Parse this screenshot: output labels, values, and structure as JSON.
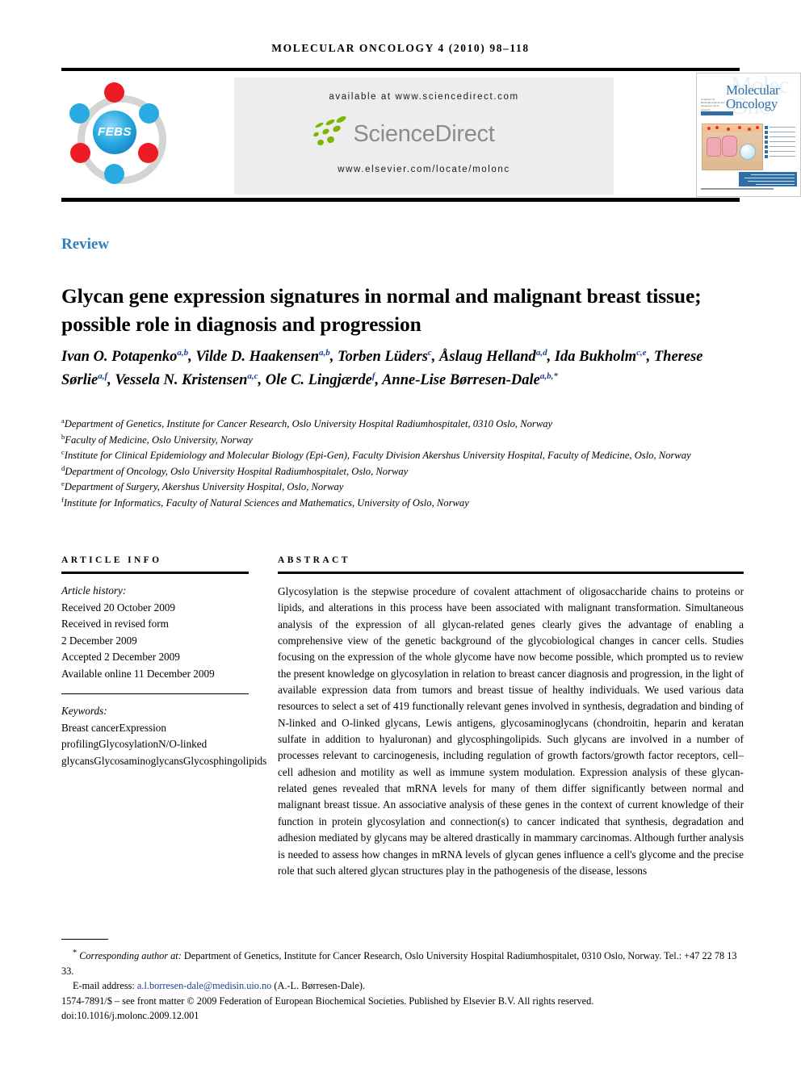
{
  "running_head": "MOLECULAR ONCOLOGY 4 (2010) 98–118",
  "masthead": {
    "febs_logo_text": "FEBS",
    "available_at": "available at www.sciencedirect.com",
    "sciencedirect_logo_text": "ScienceDirect",
    "journal_url": "www.elsevier.com/locate/molonc"
  },
  "cover": {
    "title_line1": "Molecular",
    "title_line2": "Oncology",
    "ghost_line1": "Molec",
    "ghost_line2": "Onc",
    "subtitle": "A quarter for Biotechnological and advanced cancer research",
    "footer_text": "www.elsevier.com/locate/molonc  Volume 4  Issue 2  April 2010"
  },
  "article_type": "Review",
  "title": "Glycan gene expression signatures in normal and malignant breast tissue; possible role in diagnosis and progression",
  "authors": [
    {
      "name": "Ivan O. Potapenko",
      "sup": "a,b",
      "sep": ", "
    },
    {
      "name": "Vilde D. Haakensen",
      "sup": "a,b",
      "sep": ", "
    },
    {
      "name": "Torben Lüders",
      "sup": "c",
      "sep": ",  "
    },
    {
      "name": "Åslaug Helland",
      "sup": "a,d",
      "sep": ", "
    },
    {
      "name": "Ida Bukholm",
      "sup": "c,e",
      "sep": ", "
    },
    {
      "name": "Therese Sørlie",
      "sup": "a,f",
      "sep": ", "
    },
    {
      "name": "Vessela N. Kristensen",
      "sup": "a,c",
      "sep": ", "
    },
    {
      "name": "Ole C. Lingjærde",
      "sup": "f",
      "sep": ", "
    },
    {
      "name": "Anne-Lise Børresen-Dale",
      "sup": "a,b,*",
      "sep": ""
    }
  ],
  "affiliations": [
    {
      "mark": "a",
      "text": "Department of Genetics, Institute for Cancer Research, Oslo University Hospital Radiumhospitalet, 0310 Oslo, Norway"
    },
    {
      "mark": "b",
      "text": "Faculty of Medicine, Oslo University, Norway"
    },
    {
      "mark": "c",
      "text": "Institute for Clinical Epidemiology and Molecular Biology (Epi-Gen), Faculty Division Akershus University Hospital, Faculty of Medicine, Oslo, Norway"
    },
    {
      "mark": "d",
      "text": "Department of Oncology, Oslo University Hospital Radiumhospitalet, Oslo, Norway"
    },
    {
      "mark": "e",
      "text": "Department of Surgery, Akershus University Hospital, Oslo, Norway"
    },
    {
      "mark": "f",
      "text": "Institute for Informatics, Faculty of Natural Sciences and Mathematics, University of Oslo, Norway"
    }
  ],
  "article_info": {
    "heading": "ARTICLE INFO",
    "history_label": "Article history:",
    "history_lines": [
      "Received 20 October 2009",
      "Received in revised form",
      "2 December 2009",
      "Accepted 2 December 2009",
      "Available online 11 December 2009"
    ],
    "keywords_label": "Keywords:",
    "keywords": [
      "Breast cancer",
      "Expression profiling",
      "Glycosylation",
      "N/O-linked glycans",
      "Glycosaminoglycans",
      "Glycosphingolipids"
    ]
  },
  "abstract": {
    "heading": "ABSTRACT",
    "text": "Glycosylation is the stepwise procedure of covalent attachment of oligosaccharide chains to proteins or lipids, and alterations in this process have been associated with malignant transformation. Simultaneous analysis of the expression of all glycan-related genes clearly gives the advantage of enabling a comprehensive view of the genetic background of the glycobiological changes in cancer cells. Studies focusing on the expression of the whole glycome have now become possible, which prompted us to review the present knowledge on glycosylation in relation to breast cancer diagnosis and progression, in the light of available expression data from tumors and breast tissue of healthy individuals. We used various data resources to select a set of 419 functionally relevant genes involved in synthesis, degradation and binding of N-linked and O-linked glycans, Lewis antigens, glycosaminoglycans (chondroitin, heparin and keratan sulfate in addition to hyaluronan) and glycosphingolipids. Such glycans are involved in a number of processes relevant to carcinogenesis, including regulation of growth factors/growth factor receptors, cell–cell adhesion and motility as well as immune system modulation. Expression analysis of these glycan-related genes revealed that mRNA levels for many of them differ significantly between normal and malignant breast tissue. An associative analysis of these genes in the context of current knowledge of their function in protein glycosylation and connection(s) to cancer indicated that synthesis, degradation and adhesion mediated by glycans may be altered drastically in mammary carcinomas. Although further analysis is needed to assess how changes in mRNA levels of glycan genes influence a cell's glycome and the precise role that such altered glycan structures play in the pathogenesis of the disease, lessons"
  },
  "footer": {
    "corr_marker": "*",
    "corr_label": "Corresponding author at:",
    "corr_text": " Department of Genetics, Institute for Cancer Research, Oslo University Hospital Radiumhospitalet, 0310 Oslo, Norway. Tel.: +47 22 78 13 33.",
    "email_label": "E-mail address:",
    "email": "a.l.borresen-dale@medisin.uio.no",
    "email_suffix": "(A.-L. Børresen-Dale).",
    "copyright": "1574-7891/$ – see front matter © 2009 Federation of European Biochemical Societies. Published by Elsevier B.V. All rights reserved.",
    "doi": "doi:10.1016/j.molonc.2009.12.001"
  },
  "colors": {
    "accent_blue": "#2e7ebb",
    "link_blue": "#1c3f94",
    "sciencedirect_green": "#7ab800",
    "sciencedirect_gray": "#8c8c8c",
    "band_gray": "#ededed",
    "febs_red": "#ed1c24",
    "febs_blue": "#29abe2"
  }
}
